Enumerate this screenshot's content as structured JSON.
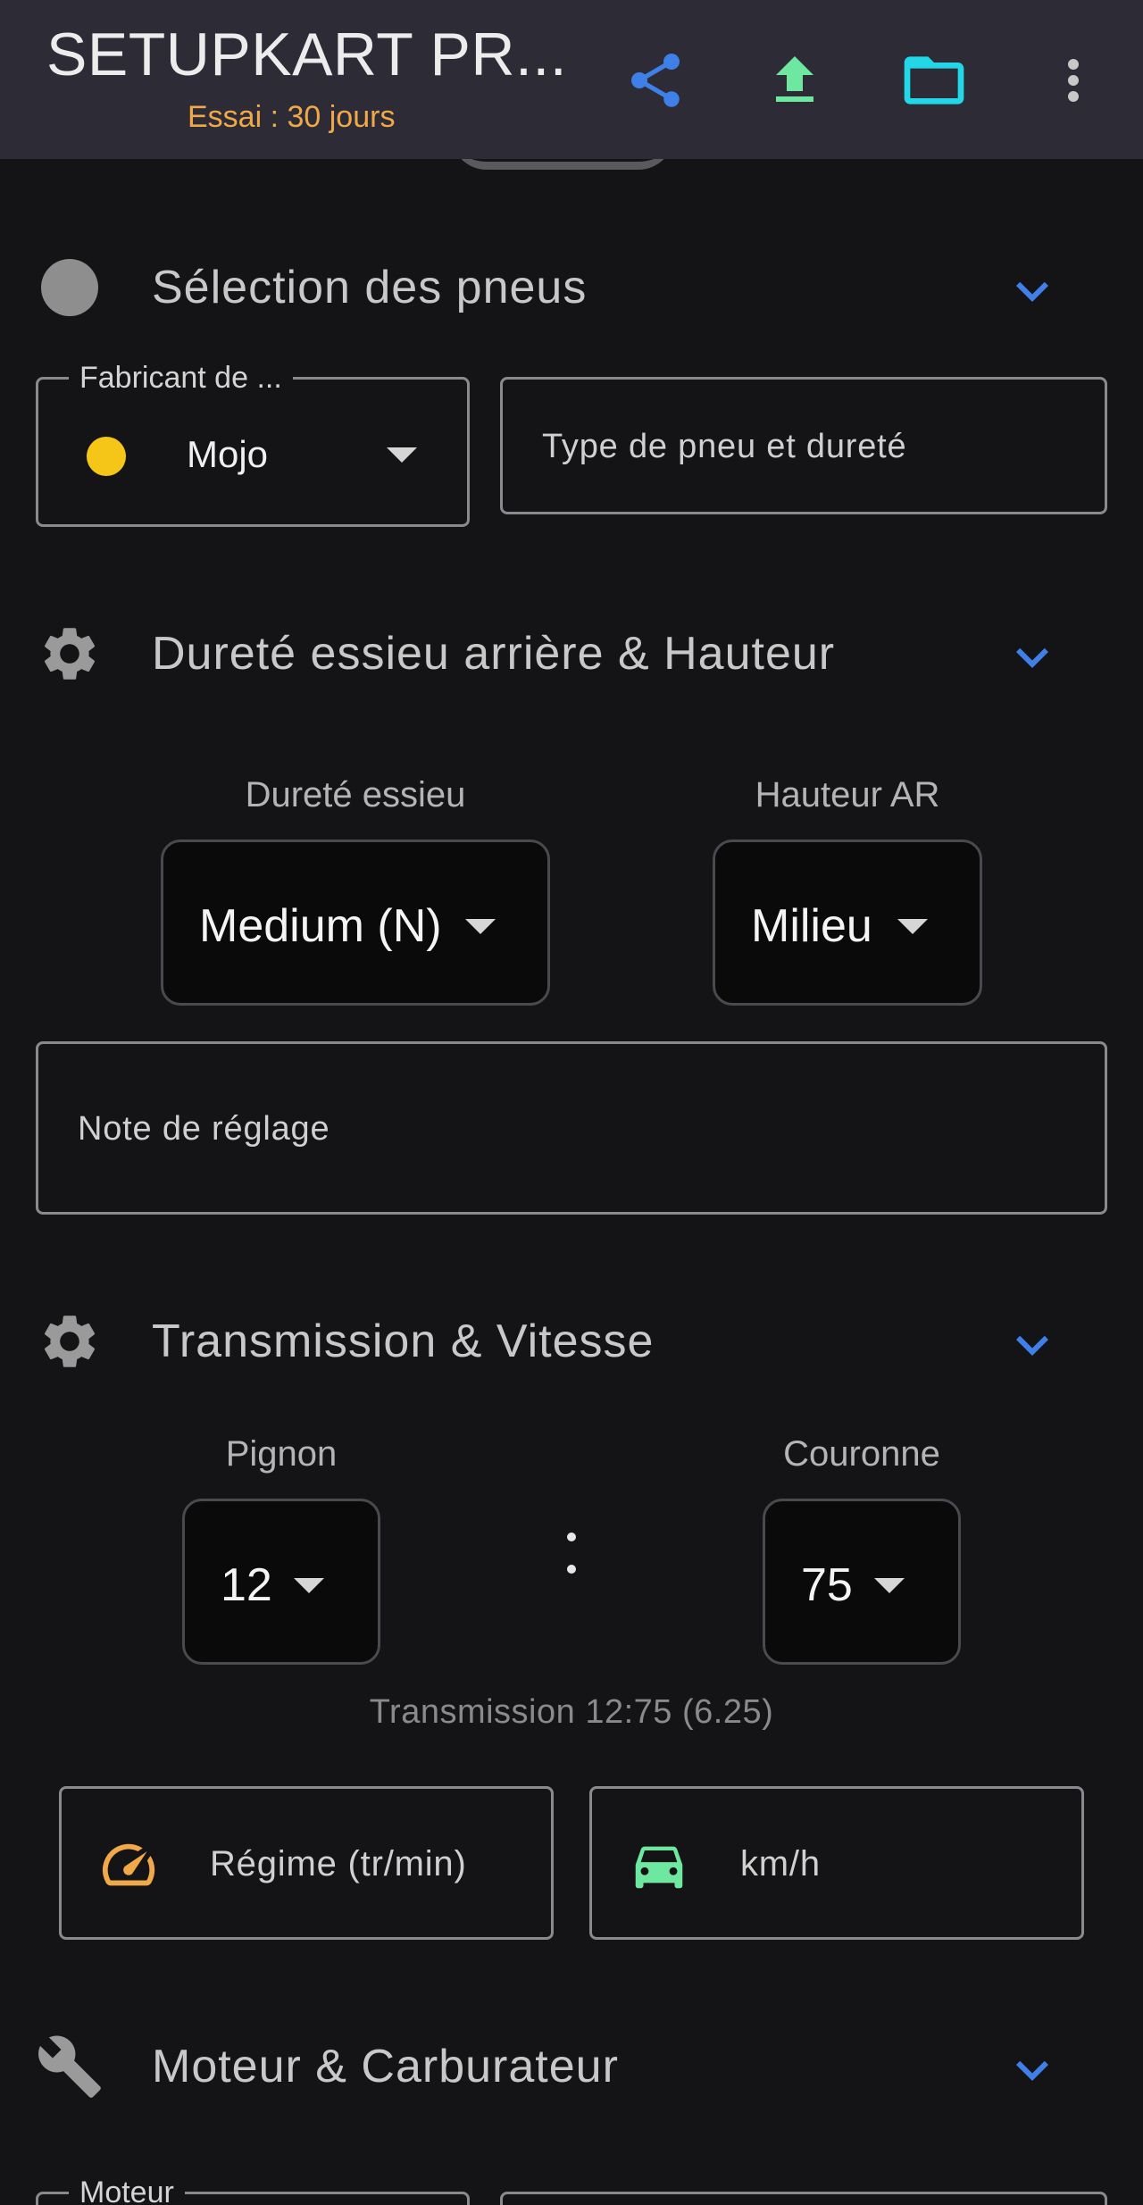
{
  "appbar": {
    "title": "SETUPKART PR...",
    "subtitle": "Essai : 30 jours",
    "actions": [
      "share-icon",
      "upload-icon",
      "folder-icon",
      "more-vert-icon"
    ],
    "colors": {
      "share": "#3f7fe8",
      "upload": "#6ee8a0",
      "folder": "#22d8e8"
    }
  },
  "tires": {
    "title": "Sélection des pneus",
    "manufacturer": {
      "label": "Fabricant de ...",
      "value": "Mojo",
      "dot_color": "#f5c518"
    },
    "type_field": {
      "placeholder": "Type de pneu et dureté"
    }
  },
  "axle": {
    "title": "Dureté essieu arrière & Hauteur",
    "hardness": {
      "label": "Dureté essieu",
      "value": "Medium (N)"
    },
    "height": {
      "label": "Hauteur AR",
      "value": "Milieu"
    },
    "note": {
      "placeholder": "Note de réglage"
    }
  },
  "transmission": {
    "title": "Transmission & Vitesse",
    "pinion": {
      "label": "Pignon",
      "value": "12"
    },
    "crown": {
      "label": "Couronne",
      "value": "75"
    },
    "ratio_text": "Transmission 12:75 (6.25)",
    "rpm": {
      "placeholder": "Régime (tr/min)",
      "icon_color": "#f0a848"
    },
    "speed": {
      "placeholder": "km/h",
      "icon_color": "#6ee8a0"
    }
  },
  "engine": {
    "title": "Moteur & Carburateur",
    "engine_field": {
      "label": "Moteur"
    }
  },
  "accent": "#3f7fe8"
}
